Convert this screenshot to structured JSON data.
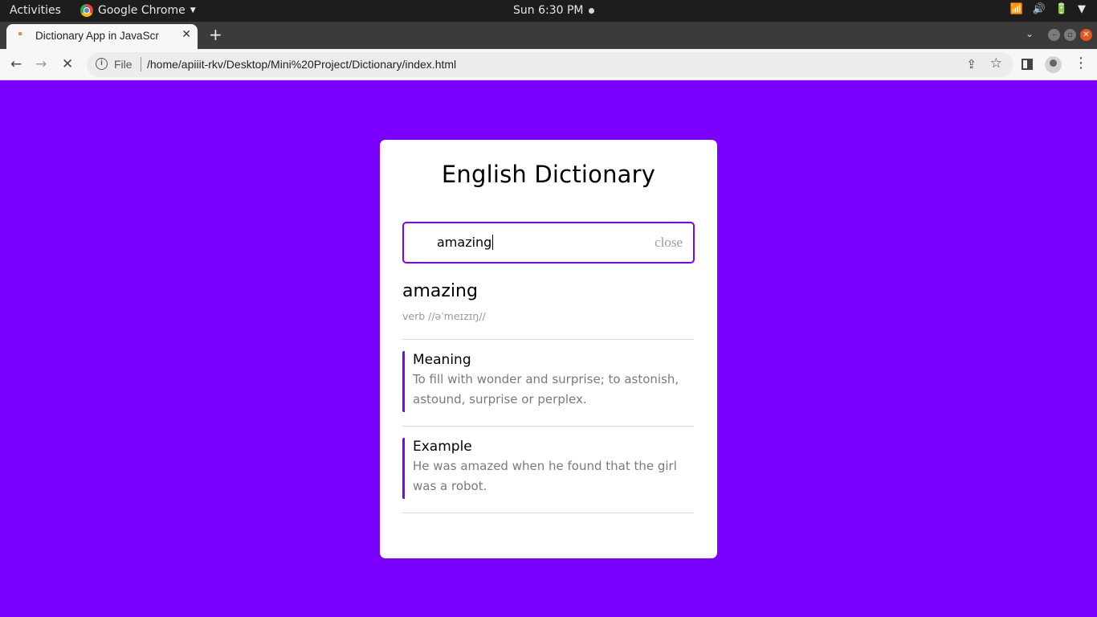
{
  "os_bar": {
    "activities": "Activities",
    "app_name": "Google Chrome",
    "clock": "Sun  6:30 PM"
  },
  "browser": {
    "tab_title": "Dictionary App in JavaScr",
    "new_tab": "+",
    "url_scheme_label": "File",
    "url": "/home/apiiit-rkv/Desktop/Mini%20Project/Dictionary/index.html"
  },
  "app": {
    "title": "English Dictionary",
    "search": {
      "value": "amazing",
      "close_label": "close"
    },
    "result": {
      "word": "amazing",
      "phonetic": "verb //əˈmeɪzɪŋ//",
      "meaning_label": "Meaning",
      "meaning_text": "To fill with wonder and surprise; to astonish, astound, surprise or perplex.",
      "example_label": "Example",
      "example_text": "He was amazed when he found that the girl was a robot."
    }
  },
  "colors": {
    "background": "#7a00ff",
    "accent": "#7a00ff",
    "card": "#ffffff"
  },
  "icons": [
    "chrome-logo-icon",
    "wifi-icon",
    "volume-icon",
    "battery-icon",
    "back-icon",
    "forward-icon",
    "stop-icon",
    "info-icon",
    "share-icon",
    "bookmark-star-icon",
    "side-panel-icon",
    "profile-icon",
    "menu-icon"
  ]
}
